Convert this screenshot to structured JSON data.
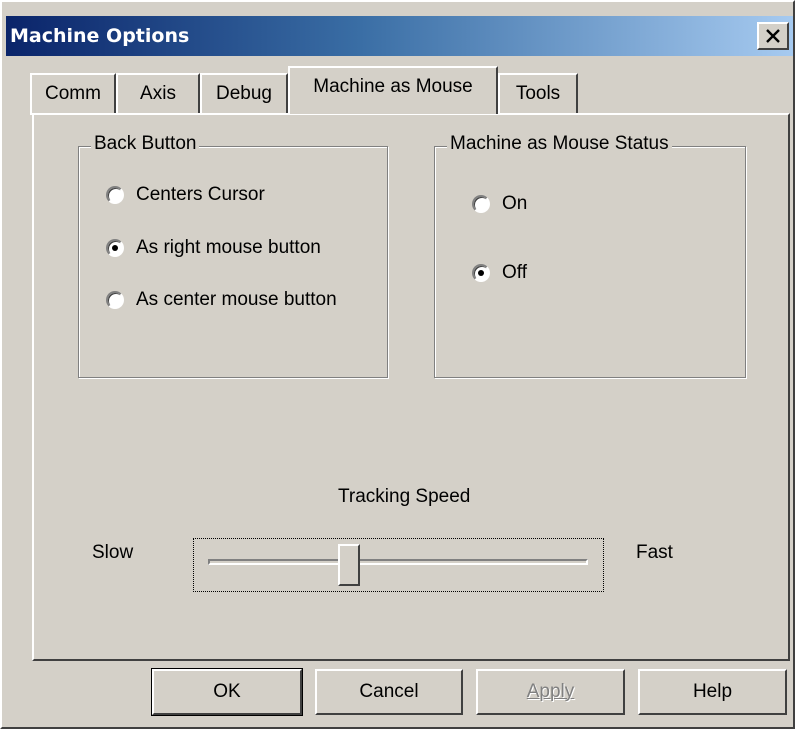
{
  "window": {
    "title": "Machine Options"
  },
  "tabs": [
    {
      "label": "Comm"
    },
    {
      "label": "Axis"
    },
    {
      "label": "Debug"
    },
    {
      "label": "Machine as Mouse",
      "active": true
    },
    {
      "label": "Tools"
    }
  ],
  "back_button": {
    "title": "Back Button",
    "options": [
      {
        "label": "Centers Cursor",
        "selected": false
      },
      {
        "label": "As right mouse button",
        "selected": true
      },
      {
        "label": "As center mouse button",
        "selected": false
      }
    ]
  },
  "status": {
    "title": "Machine as Mouse Status",
    "options": [
      {
        "label": "On",
        "selected": false
      },
      {
        "label": "Off",
        "selected": true
      }
    ]
  },
  "tracking": {
    "label": "Tracking Speed",
    "min_label": "Slow",
    "max_label": "Fast",
    "value_fraction": 0.37
  },
  "buttons": {
    "ok": "OK",
    "cancel": "Cancel",
    "apply": "Apply",
    "help": "Help"
  },
  "icons": {
    "close": "close-icon"
  }
}
